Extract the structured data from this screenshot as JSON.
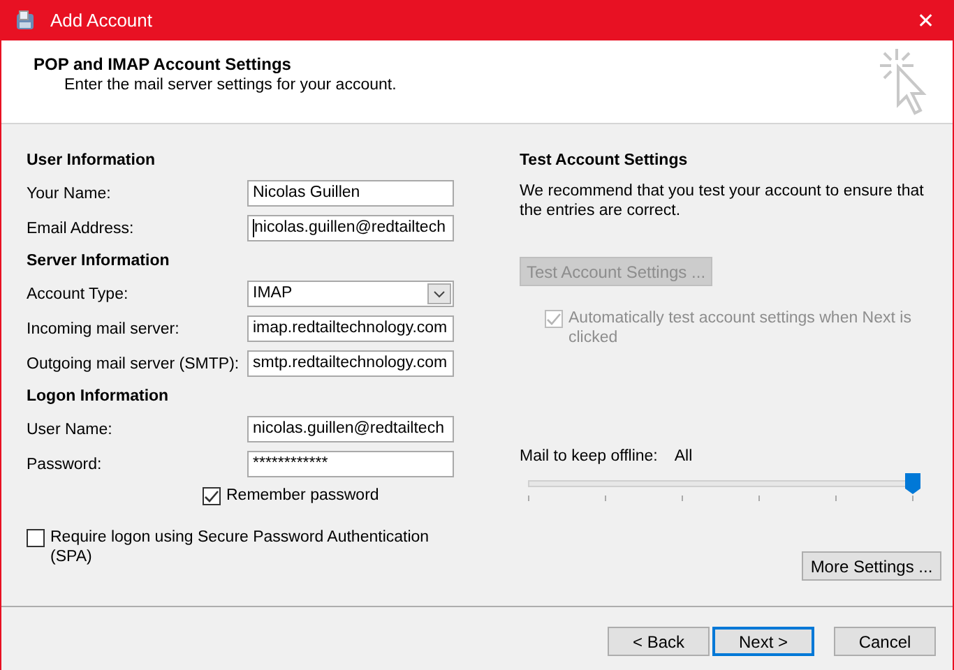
{
  "window": {
    "title": "Add Account",
    "close": "✕"
  },
  "header": {
    "title": "POP and IMAP Account Settings",
    "subtitle": "Enter the mail server settings for your account."
  },
  "left": [
    {
      "kind": "heading",
      "label": "User Information"
    },
    {
      "kind": "field",
      "label": "Your Name:",
      "value": "Nicolas Guillen"
    },
    {
      "kind": "field",
      "label": "Email Address:",
      "value": "nicolas.guillen@redtailtech",
      "focused": true
    },
    {
      "kind": "heading",
      "label": "Server Information"
    },
    {
      "kind": "select",
      "label": "Account Type:",
      "value": "IMAP"
    },
    {
      "kind": "field",
      "label": "Incoming mail server:",
      "value": "imap.redtailtechnology.com"
    },
    {
      "kind": "field",
      "label": "Outgoing mail server (SMTP):",
      "value": "smtp.redtailtechnology.com"
    },
    {
      "kind": "heading",
      "label": "Logon Information"
    },
    {
      "kind": "field",
      "label": "User Name:",
      "value": "nicolas.guillen@redtailtech"
    },
    {
      "kind": "field",
      "label": "Password:",
      "value": "************"
    },
    {
      "kind": "checkbox",
      "label": "Remember password",
      "checked": true,
      "indent": true
    },
    {
      "kind": "checkbox",
      "label": "Require logon using Secure Password Authentication (SPA)",
      "checked": false,
      "indent": false
    }
  ],
  "right": {
    "heading": "Test Account Settings",
    "description": "We recommend that you test your account to ensure that the entries are correct.",
    "test_button": {
      "label": "Test Account Settings ...",
      "disabled": true
    },
    "auto_test": {
      "label": "Automatically test account settings when Next is clicked",
      "checked": true,
      "disabled": true
    },
    "offline": {
      "label": "Mail to keep offline:",
      "value": "All",
      "level": 1
    },
    "more_settings": "More Settings ..."
  },
  "buttons": [
    {
      "label": "< Back",
      "default": false
    },
    {
      "label": "Next >",
      "default": true
    },
    {
      "label": "Cancel",
      "default": false
    }
  ]
}
